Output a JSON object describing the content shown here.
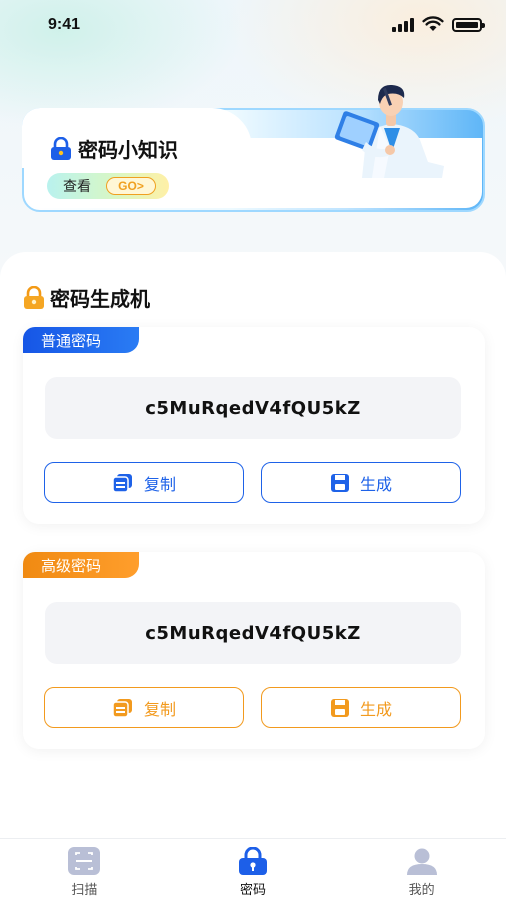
{
  "status_bar": {
    "time": "9:41"
  },
  "banner": {
    "title": "密码小知识",
    "view_label": "查看",
    "go_label": "GO>"
  },
  "generator": {
    "title": "密码生成机",
    "cards": [
      {
        "type": "normal",
        "tag": "普通密码",
        "password": "c5MuRqedV4fQU5kZ",
        "copy_label": "复制",
        "generate_label": "生成",
        "accent": "#1E62E8"
      },
      {
        "type": "advanced",
        "tag": "高级密码",
        "password": "c5MuRqedV4fQU5kZ",
        "copy_label": "复制",
        "generate_label": "生成",
        "accent": "#F29A1E"
      }
    ]
  },
  "tab_bar": {
    "items": [
      {
        "label": "扫描",
        "icon": "scan-icon",
        "active": false
      },
      {
        "label": "密码",
        "icon": "lock-icon",
        "active": true
      },
      {
        "label": "我的",
        "icon": "profile-icon",
        "active": false
      }
    ]
  }
}
